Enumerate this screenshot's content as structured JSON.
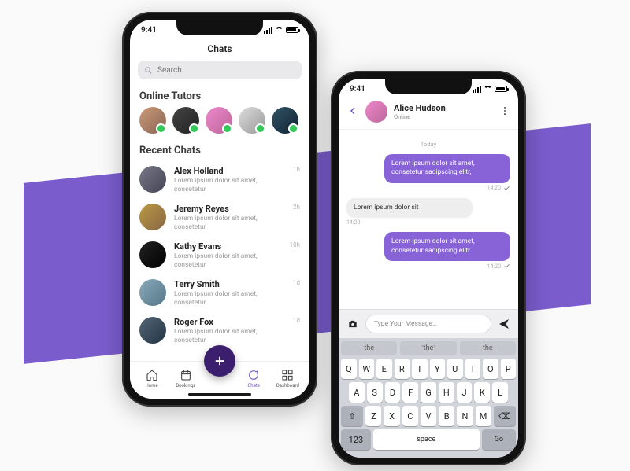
{
  "status_bar": {
    "time": "9:41"
  },
  "left": {
    "title": "Chats",
    "search_placeholder": "Search",
    "online_header": "Online Tutors",
    "recent_header": "Recent Chats",
    "chats": [
      {
        "name": "Alex Holland",
        "preview": "Lorem ipsum dolor sit amet, consetetur",
        "time": "1h"
      },
      {
        "name": "Jeremy Reyes",
        "preview": "Lorem ipsum dolor sit amet, consetetur",
        "time": "2h"
      },
      {
        "name": "Kathy Evans",
        "preview": "Lorem ipsum dolor sit amet, consetetur",
        "time": "10h"
      },
      {
        "name": "Terry Smith",
        "preview": "Lorem ipsum dolor sit amet, consetetur",
        "time": "1d"
      },
      {
        "name": "Roger Fox",
        "preview": "Lorem ipsum dolor sit amet, consetetur",
        "time": "1d"
      }
    ],
    "tabs": {
      "home": "Home",
      "bookings": "Bookings",
      "chats": "Chats",
      "dashboard": "Dashboard"
    }
  },
  "right": {
    "header": {
      "name": "Alice Hudson",
      "status": "Online"
    },
    "day_label": "Today",
    "messages": [
      {
        "side": "sent",
        "text": "Lorem ipsum dolor sit amet, consetetur sadipscing elitr,",
        "time": "14:20",
        "tick": true
      },
      {
        "side": "recv",
        "text": "Lorem ipsum dolor sit",
        "time": "14:20"
      },
      {
        "side": "sent",
        "text": "Lorem ipsum dolor sit amet, consetetur sadipscing elitr",
        "time": "14:20",
        "tick": true
      }
    ],
    "compose_placeholder": "Type Your Message…",
    "suggestions": [
      "the",
      "the",
      "the"
    ],
    "keyboard": {
      "row1": [
        "Q",
        "W",
        "E",
        "R",
        "T",
        "Y",
        "U",
        "I",
        "O",
        "P"
      ],
      "row2": [
        "A",
        "S",
        "D",
        "F",
        "G",
        "H",
        "J",
        "K",
        "L"
      ],
      "row3": [
        "Z",
        "X",
        "C",
        "V",
        "B",
        "N",
        "M"
      ],
      "shift": "⇧",
      "backspace": "⌫",
      "numbers": "123",
      "space": "space",
      "go": "Go"
    }
  },
  "colors": {
    "accent": "#8863d7",
    "brand_dark": "#3b1e6e",
    "online": "#34c759"
  }
}
